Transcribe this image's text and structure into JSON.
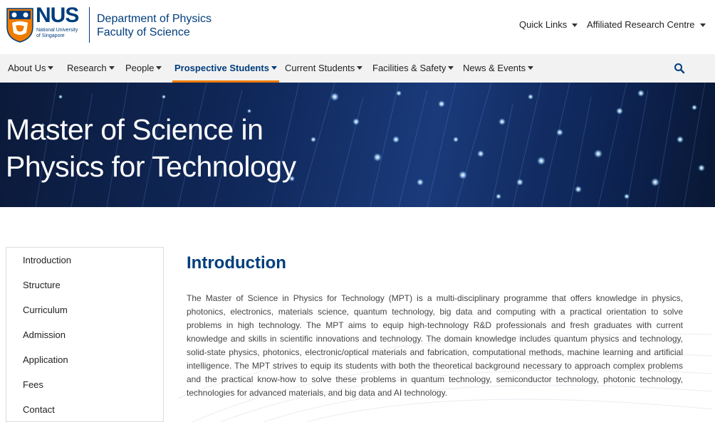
{
  "branding": {
    "nus_word": "NUS",
    "nus_sub_1": "National University",
    "nus_sub_2": "of Singapore",
    "dept": "Department of Physics",
    "faculty": "Faculty of Science",
    "brand_blue": "#003d7c",
    "accent_orange": "#ef7c00"
  },
  "utility_nav": {
    "quick_links": "Quick Links",
    "affiliated": "Affiliated Research Centre"
  },
  "main_nav": {
    "items": [
      {
        "label": "About Us"
      },
      {
        "label": "Research"
      },
      {
        "label": "People"
      },
      {
        "label": "Prospective Students"
      },
      {
        "label": "Current Students"
      },
      {
        "label": "Facilities & Safety"
      },
      {
        "label": "News & Events"
      }
    ],
    "active": "Prospective Students",
    "search_icon": "search-icon"
  },
  "hero": {
    "title_line1": "Master of Science in",
    "title_line2": "Physics for Technology"
  },
  "sidebar": {
    "items": [
      {
        "label": "Introduction"
      },
      {
        "label": "Structure"
      },
      {
        "label": "Curriculum"
      },
      {
        "label": "Admission"
      },
      {
        "label": "Application"
      },
      {
        "label": "Fees"
      },
      {
        "label": "Contact"
      }
    ]
  },
  "content": {
    "title": "Introduction",
    "paragraph": "The Master of Science in Physics for Technology (MPT) is a multi-disciplinary programme that offers knowledge in physics, photonics, electronics, materials science, quantum technology, big data and computing with a practical orientation to solve problems in high technology. The MPT aims to equip high-technology R&D professionals and fresh graduates with current knowledge and skills in scientific innovations and technology. The domain knowledge includes quantum physics and technology, solid-state physics, photonics, electronic/optical materials and fabrication, computational methods, machine learning and artificial intelligence. The MPT strives to equip its students with both the theoretical background necessary to approach complex problems and the practical know-how to solve these problems in quantum technology, semiconductor technology, photonic technology, technologies for advanced materials, and big data and AI technology."
  }
}
